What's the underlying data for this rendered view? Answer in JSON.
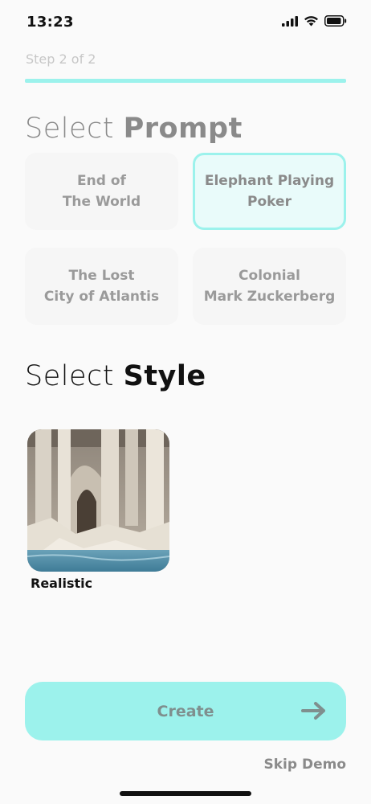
{
  "status_bar": {
    "time": "13:23"
  },
  "step_label": "Step 2 of 2",
  "progress": 1.0,
  "prompt_section": {
    "title_light": "Select ",
    "title_bold": "Prompt",
    "options": [
      {
        "label": "End of\nThe World",
        "selected": false
      },
      {
        "label": "Elephant Playing\nPoker",
        "selected": true
      },
      {
        "label": "The Lost\nCity of Atlantis",
        "selected": false
      },
      {
        "label": "Colonial\nMark Zuckerberg",
        "selected": false
      }
    ]
  },
  "style_section": {
    "title_light": "Select ",
    "title_bold": "Style",
    "options": [
      {
        "label": "Realistic"
      }
    ]
  },
  "create_button": {
    "label": "Create",
    "icon": "arrow-right-icon"
  },
  "skip_demo": "Skip Demo",
  "colors": {
    "accent": "#9cf2ec",
    "selected_bg": "#e9fbfa"
  }
}
